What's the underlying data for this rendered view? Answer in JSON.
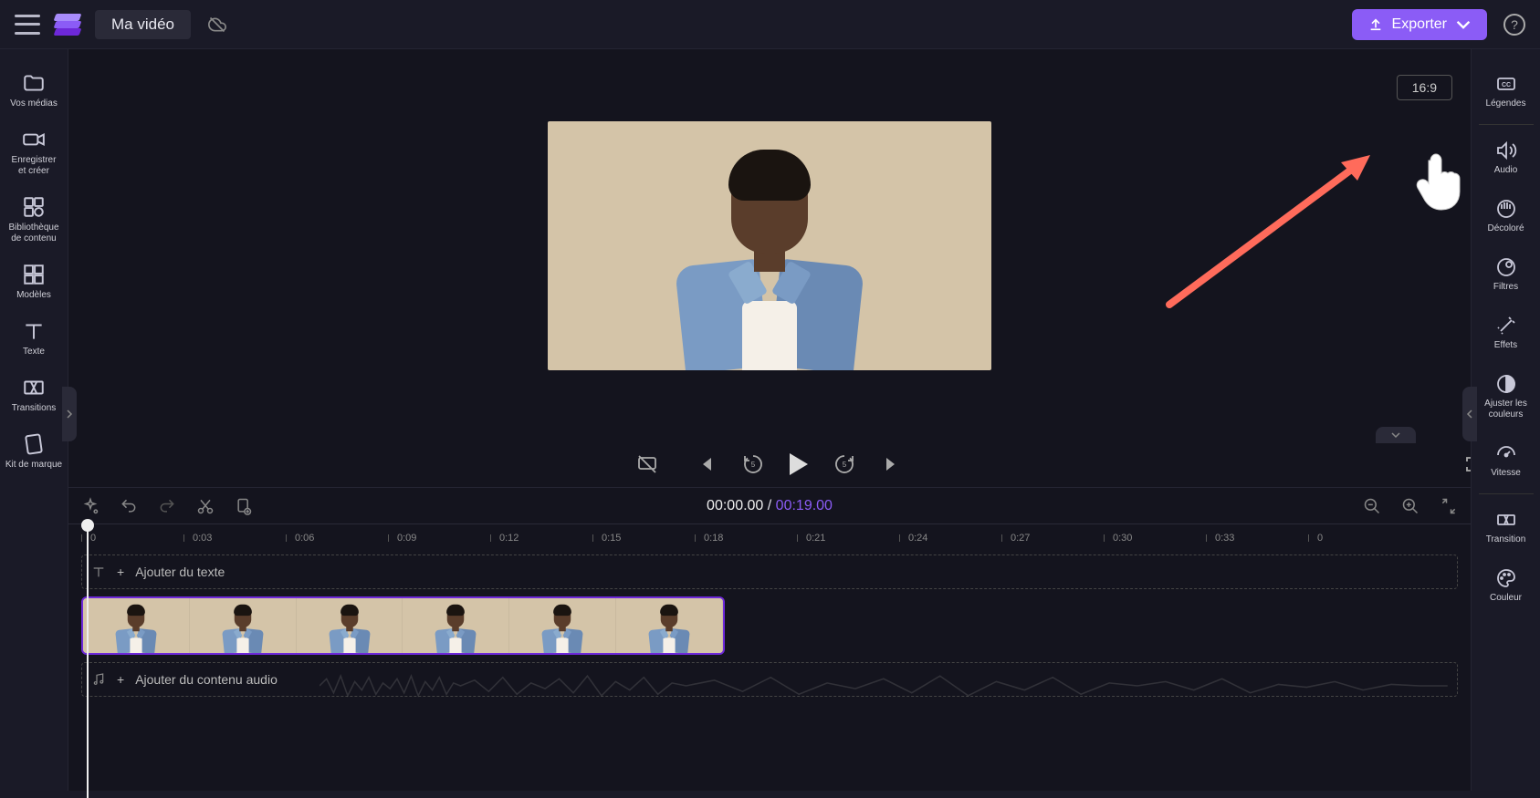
{
  "header": {
    "title": "Ma vidéo",
    "export_label": "Exporter"
  },
  "left_sidebar": {
    "items": [
      {
        "label": "Vos médias"
      },
      {
        "label": "Enregistrer\net créer"
      },
      {
        "label": "Bibliothèque\nde contenu"
      },
      {
        "label": "Modèles"
      },
      {
        "label": "Texte"
      },
      {
        "label": "Transitions"
      },
      {
        "label": "Kit de marque"
      }
    ]
  },
  "preview": {
    "aspect_ratio": "16:9"
  },
  "timecode": {
    "current": "00:00.00",
    "separator": " / ",
    "total": "00:19.00"
  },
  "ruler": {
    "marks": [
      "0",
      "0:03",
      "0:06",
      "0:09",
      "0:12",
      "0:15",
      "0:18",
      "0:21",
      "0:24",
      "0:27",
      "0:30",
      "0:33",
      "0"
    ]
  },
  "tracks": {
    "text_label": "Ajouter du texte",
    "audio_label": "Ajouter du contenu audio"
  },
  "right_sidebar": {
    "items": [
      {
        "label": "Légendes"
      },
      {
        "label": "Audio"
      },
      {
        "label": "Décoloré"
      },
      {
        "label": "Filtres"
      },
      {
        "label": "Effets"
      },
      {
        "label": "Ajuster les\ncouleurs"
      },
      {
        "label": "Vitesse"
      },
      {
        "label": "Transition"
      },
      {
        "label": "Couleur"
      }
    ]
  }
}
